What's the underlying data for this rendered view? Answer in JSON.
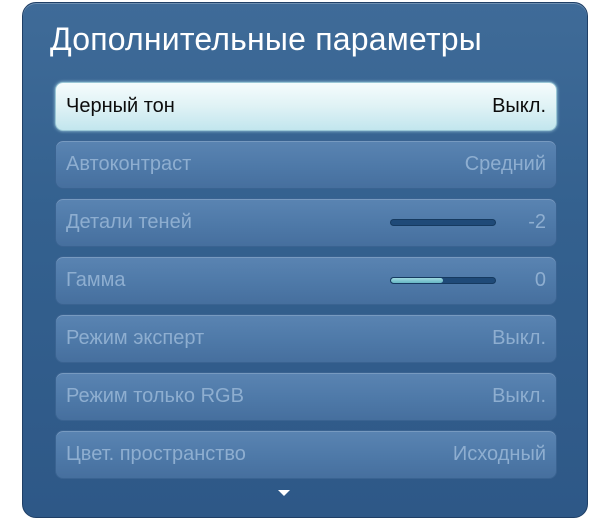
{
  "title": "Дополнительные параметры",
  "items": [
    {
      "label": "Черный тон",
      "value": "Выкл."
    },
    {
      "label": "Автоконтраст",
      "value": "Средний"
    },
    {
      "label": "Детали теней",
      "value": "-2",
      "slider_level": 0
    },
    {
      "label": "Гамма",
      "value": "0",
      "slider_level": 0.5
    },
    {
      "label": "Режим эксперт",
      "value": "Выкл."
    },
    {
      "label": "Режим только RGB",
      "value": "Выкл."
    },
    {
      "label": "Цвет. пространство",
      "value": "Исходный"
    }
  ],
  "selected_index": 0,
  "icons": {
    "scroll_down": "triangle-down-icon"
  },
  "colors": {
    "panel_background": "#34618f",
    "selected_row": "#dff2f5",
    "row_background": "#4e79a8",
    "slider_fill": "#66b6c4"
  }
}
